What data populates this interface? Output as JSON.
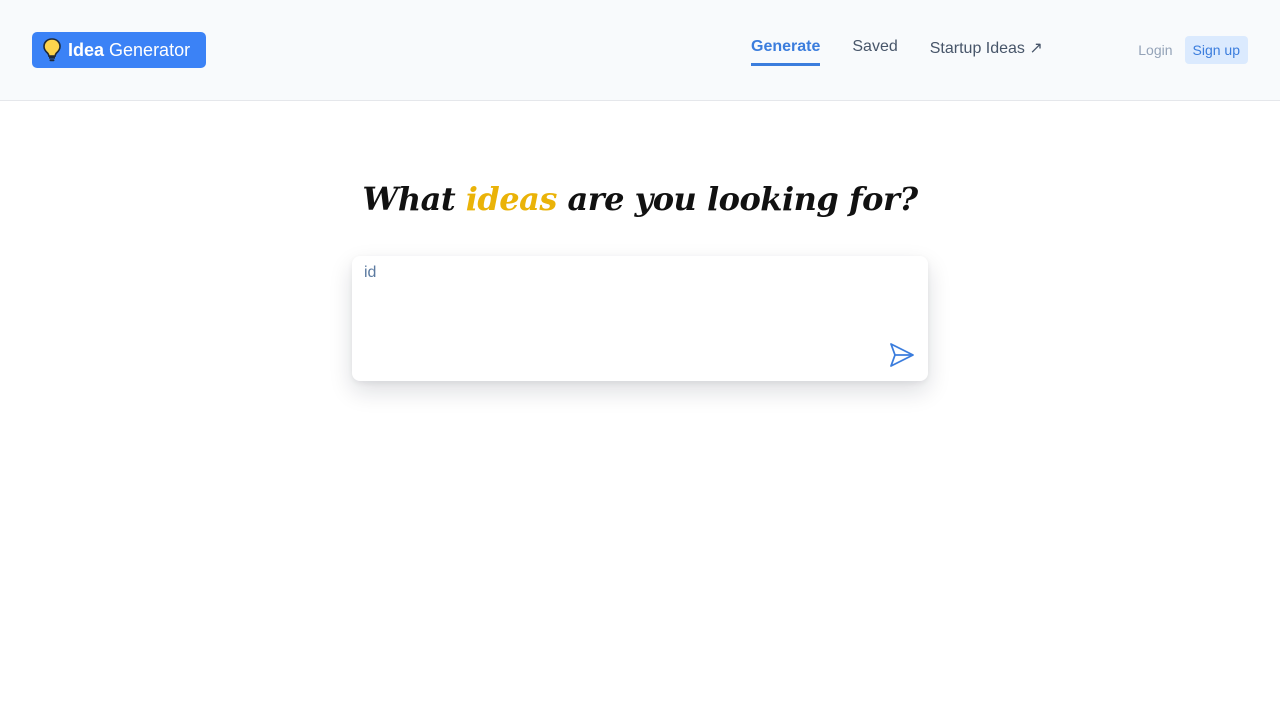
{
  "header": {
    "logo": {
      "bold_text": "Idea",
      "text": "Generator",
      "icon": "lightbulb-icon",
      "background_color": "#3b82f6"
    },
    "nav": {
      "items": [
        {
          "label": "Generate",
          "active": true
        },
        {
          "label": "Saved",
          "active": false
        },
        {
          "label": "Startup Ideas ↗",
          "active": false
        }
      ]
    },
    "auth": {
      "login_label": "Login",
      "signup_label": "Sign up"
    }
  },
  "main": {
    "headline": {
      "before": "What",
      "accent": "ideas",
      "after": "are you looking for?",
      "accent_color": "#eab308"
    },
    "input": {
      "value": "id",
      "send_icon": "send-icon"
    }
  },
  "colors": {
    "primary": "#3b7ddd",
    "header_background": "#f8fafc"
  }
}
